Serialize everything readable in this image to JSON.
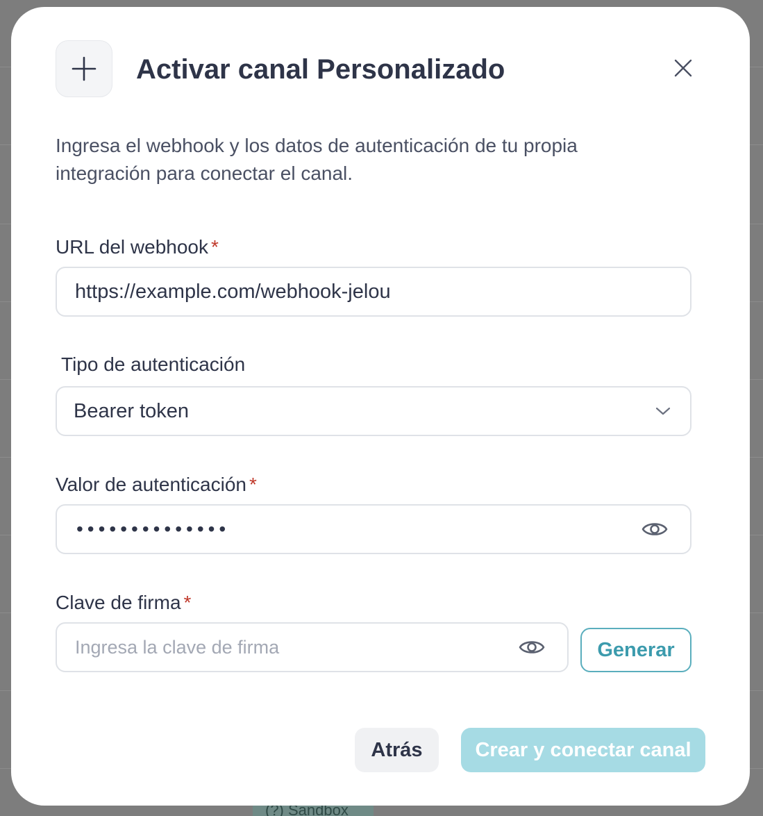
{
  "backdrop": {
    "chip_label": "(?) Sandbox"
  },
  "modal": {
    "title": "Activar canal Personalizado",
    "header_icon": "plus-icon",
    "close_icon": "close-icon",
    "description": "Ingresa el webhook y los datos de autenticación de tu propia integración para conectar el canal."
  },
  "form": {
    "webhook": {
      "label": "URL del webhook",
      "required_mark": "*",
      "value": "https://example.com/webhook-jelou"
    },
    "auth_type": {
      "label": "Tipo de autenticación",
      "selected": "Bearer token",
      "icon": "chevron-down-icon"
    },
    "auth_value": {
      "label": "Valor de autenticación",
      "required_mark": "*",
      "masked_value": "••••••••••••••",
      "icon": "eye-icon"
    },
    "signing_key": {
      "label": "Clave de firma",
      "required_mark": "*",
      "placeholder": "Ingresa la clave de firma",
      "icon": "eye-icon",
      "generate_label": "Generar"
    }
  },
  "footer": {
    "back_label": "Atrás",
    "create_label": "Crear y conectar canal"
  },
  "colors": {
    "accent": "#5aaebd",
    "primary_disabled": "#a6dbe4",
    "required": "#c0392b",
    "text": "#2e3448"
  }
}
